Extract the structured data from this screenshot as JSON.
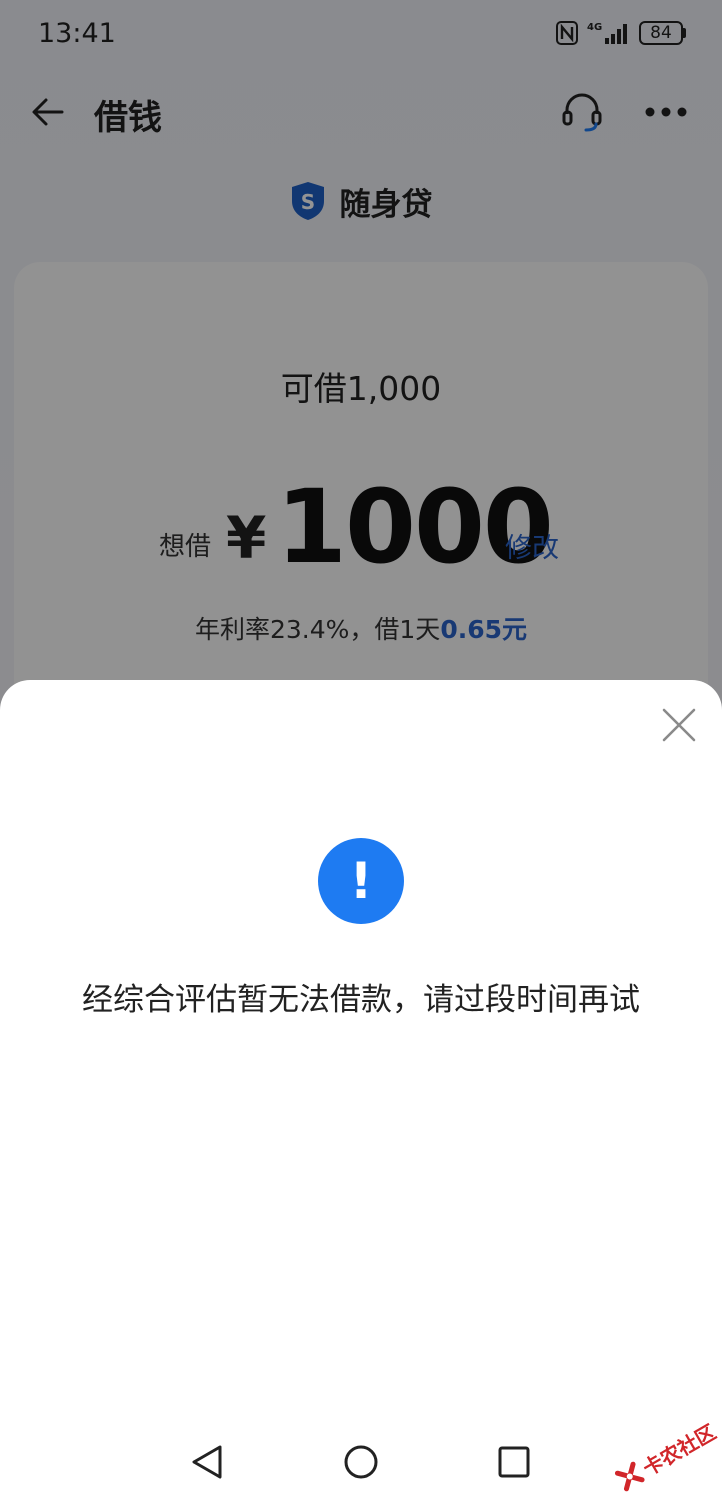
{
  "status_bar": {
    "time": "13:41",
    "network": "4G",
    "battery": "84"
  },
  "nav": {
    "title": "借钱"
  },
  "brand": {
    "name": "随身贷",
    "logo_letter": "S"
  },
  "card": {
    "available_text": "可借1,000",
    "want_label": "想借",
    "currency": "¥",
    "amount": "1000",
    "modify_label": "修改",
    "rate_prefix": "年利率23.4%，借1天",
    "rate_daily": "0.65元"
  },
  "sheet": {
    "alert_symbol": "!",
    "message": "经综合评估暂无法借款，请过段时间再试"
  },
  "watermark": {
    "text": "卡农社区"
  },
  "colors": {
    "accent_blue": "#1e7bf2",
    "link_blue": "#2a63c9",
    "watermark_red": "#d1262a"
  }
}
